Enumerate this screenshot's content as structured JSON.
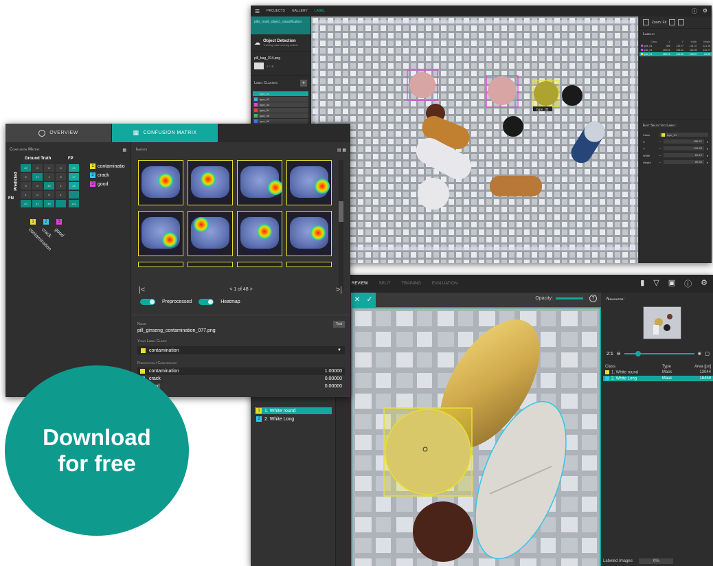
{
  "window1": {
    "topbar": {
      "menu_icon": "menu-icon",
      "projects": "PROJECTS",
      "gallery": "GALLERY",
      "active_tab": "LABEL",
      "icons": [
        "help-icon",
        "gear-icon"
      ]
    },
    "project_title": "pills_multi_object_classification",
    "project_type": "Object Detection",
    "project_sub": "Training data is being edited",
    "file_name": "pill_bag_014.png",
    "file_counter": "1 / 18",
    "label_classes_title": "Label Classes:",
    "label_classes": [
      {
        "label": "type_01",
        "color": "#13a89e"
      },
      {
        "label": "type_02",
        "color": "#4aa8e0"
      },
      {
        "label": "type_03",
        "color": "#e040e0"
      },
      {
        "label": "type_04",
        "color": "#e04040"
      },
      {
        "label": "type_05",
        "color": "#30c060"
      },
      {
        "label": "type_06",
        "color": "#4080ff"
      }
    ],
    "zoom_label": "Zoom: Fit",
    "labels_title": "Labels:",
    "labels_table": {
      "headers": [
        "Class",
        "X",
        "Y",
        "Width",
        "Height"
      ],
      "rows": [
        {
          "cells": [
            "type_01",
            "456",
            "132.77",
            "131.37",
            "121.19"
          ],
          "color": "#e040e0",
          "selected": false
        },
        {
          "cells": [
            "type_01",
            "199.01",
            "106.22",
            "114.25",
            "131.77"
          ],
          "color": "#e040e0",
          "selected": false
        },
        {
          "cells": [
            "type_01",
            "456.21",
            "131.59",
            "100.37",
            "81.06"
          ],
          "color": "#e8e02a",
          "selected": true
        }
      ]
    },
    "edit_title": "Edit Selected Label:",
    "edit_class_label": "Class",
    "edit_class_value": "type_01",
    "edit_fields": [
      {
        "label": "X",
        "value": "456.21"
      },
      {
        "label": "Y",
        "value": "131.59"
      },
      {
        "label": "Width",
        "value": "81.12"
      },
      {
        "label": "Height",
        "value": "80.34"
      }
    ],
    "bbox_label": "type_01"
  },
  "window2": {
    "tab_overview": "OVERVIEW",
    "tab_confusion": "CONFUSION MATRIX",
    "cm_title": "Confusion Matrix",
    "cm_header_gt": "Ground Truth",
    "cm_header_fp": "FP",
    "cm_predicted": "Predicted",
    "cm_fn": "FN",
    "cm_rows": [
      [
        "40",
        "0",
        "0",
        "0",
        "40"
      ],
      [
        "0",
        "47",
        "1",
        "3",
        "47"
      ],
      [
        "0",
        "0",
        "45",
        "1",
        "45"
      ],
      [
        "1",
        "0",
        "0",
        "1",
        ""
      ],
      [
        "40",
        "47",
        "48",
        "",
        "144"
      ]
    ],
    "classes": [
      {
        "num": "1",
        "label": "contaminatio",
        "color": "#e8e02a",
        "axis_label": "contamination"
      },
      {
        "num": "2",
        "label": "crack",
        "color": "#30c8e8",
        "axis_label": "crack"
      },
      {
        "num": "3",
        "label": "good",
        "color": "#e040e0",
        "axis_label": "good"
      }
    ],
    "images_title": "Images",
    "pager": "1 of 48",
    "toggle_preprocessed": "Preprocessed",
    "toggle_heatmap": "Heatmap",
    "name_label": "Name:",
    "name_value": "pill_ginseng_contamination_077.png",
    "test_btn": "Test",
    "label_class_label": "Your Label Class:",
    "label_class_value": "contamination",
    "prediction_label": "Prediction / Confidence:",
    "predictions": [
      {
        "label": "contamination",
        "value": "1.00000",
        "color": "#e8e02a"
      },
      {
        "label": "crack",
        "value": "0.00000",
        "color": "#30c8e8"
      },
      {
        "label": "good",
        "value": "0.00000",
        "color": "#e040e0"
      }
    ]
  },
  "window3": {
    "tabs": [
      "REVIEW",
      "SPLIT",
      "TRAINING",
      "EVALUATION"
    ],
    "active_tab": "REVIEW",
    "classes": [
      {
        "num": "1",
        "label": "1. White round",
        "color": "#e8e02a",
        "selected": true
      },
      {
        "num": "2",
        "label": "2. White Long",
        "color": "#30c8e8",
        "selected": false
      }
    ],
    "opacity_label": "Opacity:",
    "navigator_title": "Navigator:",
    "zoom_ratio": "2:1",
    "table_headers": [
      "Class",
      "Type",
      "Area [px]"
    ],
    "table_rows": [
      {
        "class": "1. White round",
        "type": "Mask",
        "area": "13044",
        "color": "#e8e02a",
        "selected": false
      },
      {
        "class": "2. White Long",
        "type": "Mask",
        "area": "18459",
        "color": "#30c8e8",
        "selected": true
      }
    ],
    "labeled_images_label": "Labeled Images:",
    "labeled_images_value": "0%"
  },
  "badge": {
    "line1": "Download",
    "line2": "for free"
  },
  "colors": {
    "accent": "#13a89e",
    "badge": "#0f9a8e"
  }
}
